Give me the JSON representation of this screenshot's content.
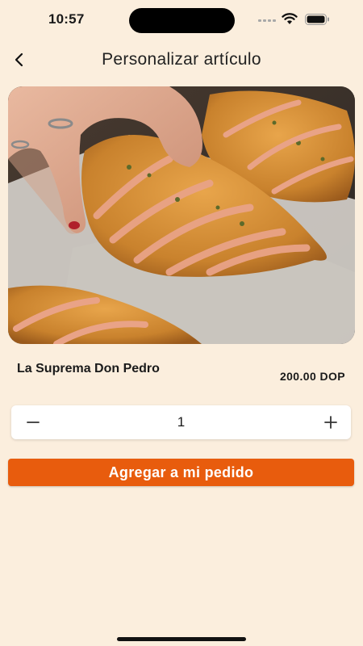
{
  "status_bar": {
    "time": "10:57"
  },
  "header": {
    "title": "Personalizar artículo",
    "back_icon": "chevron-left-icon"
  },
  "product": {
    "name": "La Suprema Don Pedro",
    "price": "200.00 DOP"
  },
  "stepper": {
    "minus_label": "−",
    "quantity": "1",
    "plus_label": "+"
  },
  "cta": {
    "label": "Agregar a mi pedido"
  },
  "colors": {
    "background": "#FBEEDD",
    "accent": "#E85C0D",
    "stepper_bg": "#FFFFFF"
  }
}
